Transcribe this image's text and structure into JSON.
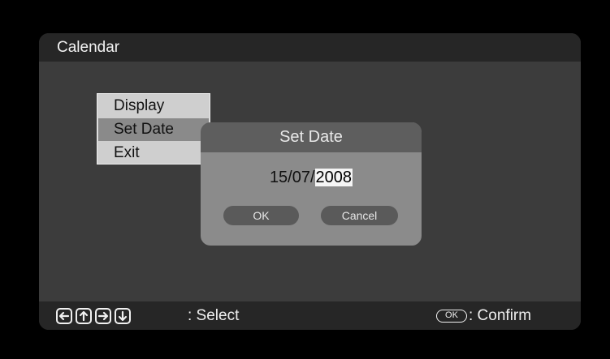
{
  "screen": {
    "title": "Calendar"
  },
  "menu": {
    "items": [
      {
        "label": "Display",
        "selected": false
      },
      {
        "label": "Set Date",
        "selected": true
      },
      {
        "label": "Exit",
        "selected": false
      }
    ]
  },
  "dialog": {
    "title": "Set Date",
    "date_prefix": "15/07/",
    "date_year": "2008",
    "ok_label": "OK",
    "cancel_label": "Cancel"
  },
  "footer": {
    "nav_keys": [
      "arrow-left-icon",
      "arrow-up-icon",
      "arrow-right-icon",
      "arrow-down-icon"
    ],
    "select_label": ": Select",
    "ok_key_label": "OK",
    "confirm_label": ": Confirm"
  }
}
